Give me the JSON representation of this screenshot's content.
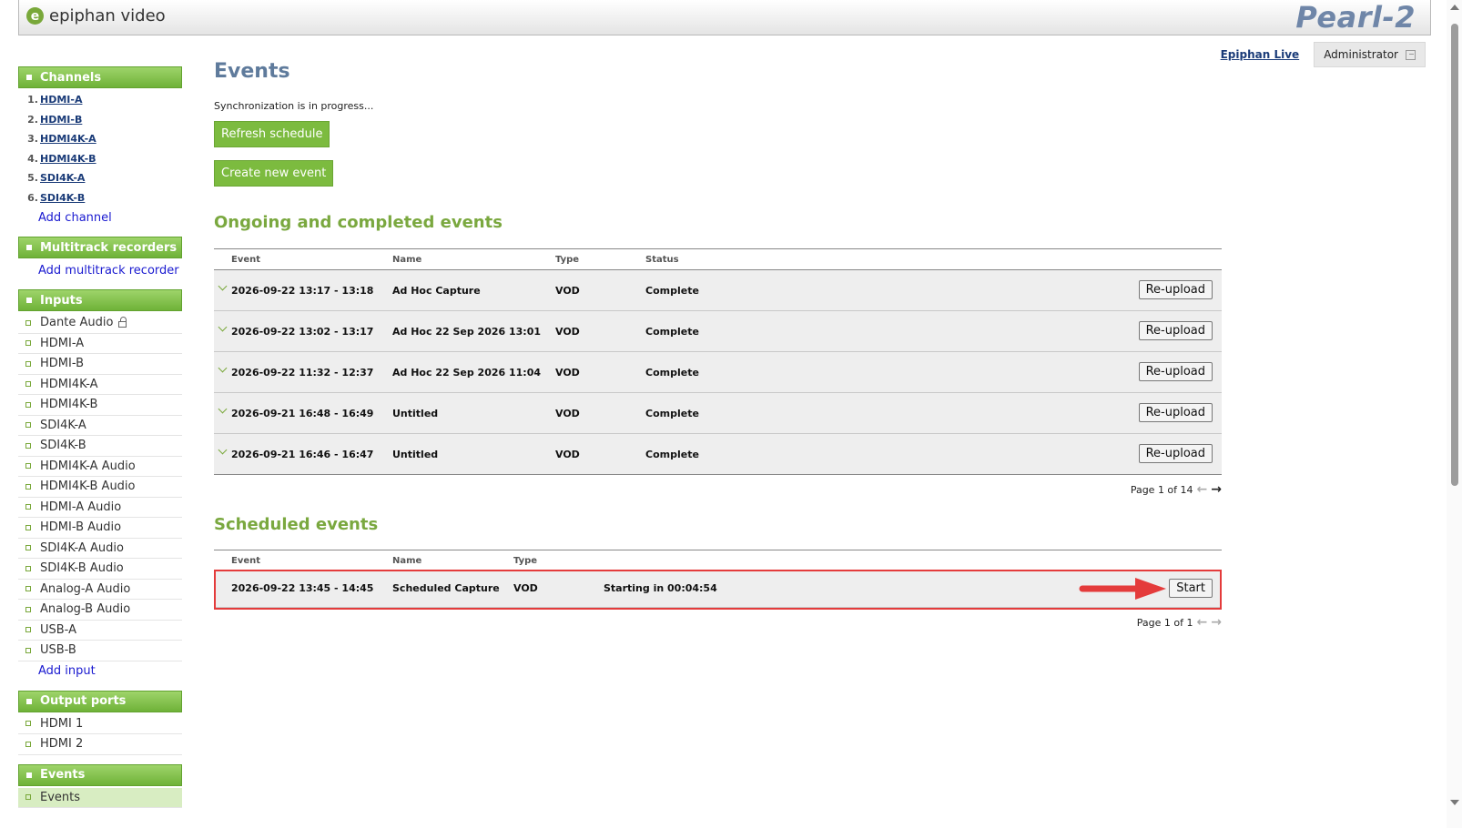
{
  "header": {
    "logo_mark": "e",
    "logo_text": "epiphan video",
    "product": "Pearl-2"
  },
  "topbar": {
    "live_link": "Epiphan Live",
    "admin_label": "Administrator"
  },
  "sidebar": {
    "channels_title": "Channels",
    "channels": [
      {
        "num": "1.",
        "label": "HDMI-A"
      },
      {
        "num": "2.",
        "label": "HDMI-B"
      },
      {
        "num": "3.",
        "label": "HDMI4K-A"
      },
      {
        "num": "4.",
        "label": "HDMI4K-B"
      },
      {
        "num": "5.",
        "label": "SDI4K-A"
      },
      {
        "num": "6.",
        "label": "SDI4K-B"
      }
    ],
    "add_channel": "Add channel",
    "recorders_title": "Multitrack recorders",
    "add_recorder": "Add multitrack recorder",
    "inputs_title": "Inputs",
    "inputs": [
      "Dante Audio",
      "HDMI-A",
      "HDMI-B",
      "HDMI4K-A",
      "HDMI4K-B",
      "SDI4K-A",
      "SDI4K-B",
      "HDMI4K-A Audio",
      "HDMI4K-B Audio",
      "HDMI-A Audio",
      "HDMI-B Audio",
      "SDI4K-A Audio",
      "SDI4K-B Audio",
      "Analog-A Audio",
      "Analog-B Audio",
      "USB-A",
      "USB-B"
    ],
    "add_input": "Add input",
    "outputs_title": "Output ports",
    "outputs": [
      "HDMI 1",
      "HDMI 2"
    ],
    "events_title": "Events",
    "events_items": [
      "Events"
    ]
  },
  "main": {
    "title": "Events",
    "sync_status": "Synchronization is in progress...",
    "refresh_button": "Refresh schedule",
    "create_button": "Create new event",
    "ongoing_title": "Ongoing and completed events",
    "columns": {
      "event": "Event",
      "name": "Name",
      "type": "Type",
      "status": "Status"
    },
    "ongoing_rows": [
      {
        "event": "2026-09-22 13:17 - 13:18",
        "name": "Ad Hoc Capture",
        "type": "VOD",
        "status": "Complete",
        "action": "Re-upload"
      },
      {
        "event": "2026-09-22 13:02 - 13:17",
        "name": "Ad Hoc 22 Sep 2026 13:01",
        "type": "VOD",
        "status": "Complete",
        "action": "Re-upload"
      },
      {
        "event": "2026-09-22 11:32 - 12:37",
        "name": "Ad Hoc 22 Sep 2026 11:04",
        "type": "VOD",
        "status": "Complete",
        "action": "Re-upload"
      },
      {
        "event": "2026-09-21 16:48 - 16:49",
        "name": "Untitled",
        "type": "VOD",
        "status": "Complete",
        "action": "Re-upload"
      },
      {
        "event": "2026-09-21 16:46 - 16:47",
        "name": "Untitled",
        "type": "VOD",
        "status": "Complete",
        "action": "Re-upload"
      }
    ],
    "ongoing_pager": "Page 1 of 14",
    "scheduled_title": "Scheduled events",
    "scheduled_rows": [
      {
        "event": "2026-09-22 13:45 - 14:45",
        "name": "Scheduled Capture",
        "type": "VOD",
        "status": "Starting in 00:04:54",
        "action": "Start"
      }
    ],
    "scheduled_pager": "Page 1 of 1"
  },
  "colors": {
    "accent_green": "#7cbb3f",
    "title_blue": "#5f7b9c",
    "annotation_red": "#e43b3b"
  }
}
